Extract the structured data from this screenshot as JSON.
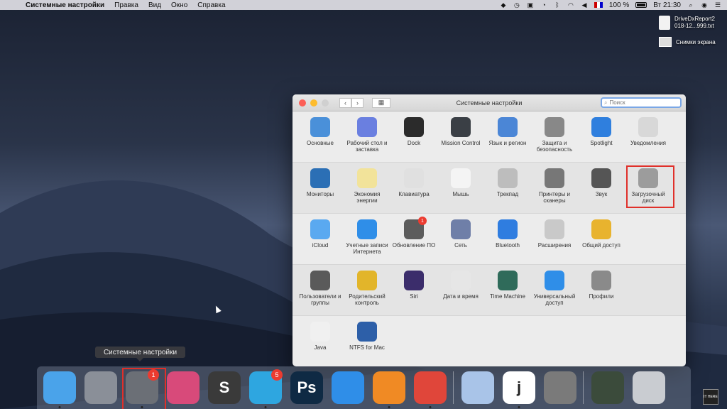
{
  "menubar": {
    "app_name": "Системные настройки",
    "items": [
      "Правка",
      "Вид",
      "Окно",
      "Справка"
    ],
    "battery": "100 %",
    "clock": "Вт 21:30"
  },
  "desktop": {
    "file1": {
      "name": "DriveDxReport2\n018-12...999.txt",
      "name_line1": "DriveDxReport2",
      "name_line2": "018-12...999.txt"
    },
    "file2": {
      "name": "Снимки экрана"
    }
  },
  "window": {
    "title": "Системные настройки",
    "search_placeholder": "Поиск",
    "rows": [
      [
        {
          "label": "Основные",
          "icon": "general-icon",
          "color": "#4a90d9"
        },
        {
          "label": "Рабочий стол и заставка",
          "icon": "desktop-icon",
          "color": "#6a7fe0"
        },
        {
          "label": "Dock",
          "icon": "dock-icon",
          "color": "#2b2b2b"
        },
        {
          "label": "Mission Control",
          "icon": "mission-control-icon",
          "color": "#3a3f45"
        },
        {
          "label": "Язык и регион",
          "icon": "language-icon",
          "color": "#4b86d6"
        },
        {
          "label": "Защита и безопасность",
          "icon": "security-icon",
          "color": "#888888"
        },
        {
          "label": "Spotlight",
          "icon": "spotlight-icon",
          "color": "#2f7fde"
        },
        {
          "label": "Уведомления",
          "icon": "notifications-icon",
          "color": "#d8d8d8"
        }
      ],
      [
        {
          "label": "Мониторы",
          "icon": "displays-icon",
          "color": "#2b6fb5"
        },
        {
          "label": "Экономия энергии",
          "icon": "energy-icon",
          "color": "#f2e39a"
        },
        {
          "label": "Клавиатура",
          "icon": "keyboard-icon",
          "color": "#e0e0e0"
        },
        {
          "label": "Мышь",
          "icon": "mouse-icon",
          "color": "#f4f4f4"
        },
        {
          "label": "Трекпад",
          "icon": "trackpad-icon",
          "color": "#bdbdbd"
        },
        {
          "label": "Принтеры и сканеры",
          "icon": "printers-icon",
          "color": "#777777"
        },
        {
          "label": "Звук",
          "icon": "sound-icon",
          "color": "#555555"
        },
        {
          "label": "Загрузочный диск",
          "icon": "startup-disk-icon",
          "color": "#9c9c9c"
        }
      ],
      [
        {
          "label": "iCloud",
          "icon": "icloud-icon",
          "color": "#5aa9f0"
        },
        {
          "label": "Учетные записи Интернета",
          "icon": "internet-accounts-icon",
          "color": "#2f8ee8"
        },
        {
          "label": "Обновление ПО",
          "icon": "software-update-icon",
          "color": "#5c5c5c",
          "badge": "1"
        },
        {
          "label": "Сеть",
          "icon": "network-icon",
          "color": "#6f7fa8"
        },
        {
          "label": "Bluetooth",
          "icon": "bluetooth-icon",
          "color": "#2f7de0"
        },
        {
          "label": "Расширения",
          "icon": "extensions-icon",
          "color": "#c9c9c9"
        },
        {
          "label": "Общий доступ",
          "icon": "sharing-icon",
          "color": "#e8b32e"
        }
      ],
      [
        {
          "label": "Пользователи и группы",
          "icon": "users-icon",
          "color": "#5a5a5a"
        },
        {
          "label": "Родительский контроль",
          "icon": "parental-icon",
          "color": "#e2b52a"
        },
        {
          "label": "Siri",
          "icon": "siri-icon",
          "color": "#3b2d6b"
        },
        {
          "label": "Дата и время",
          "icon": "date-time-icon",
          "color": "#e6e6e6"
        },
        {
          "label": "Time Machine",
          "icon": "time-machine-icon",
          "color": "#2f6b5a"
        },
        {
          "label": "Универсальный доступ",
          "icon": "accessibility-icon",
          "color": "#2f8ee8"
        },
        {
          "label": "Профили",
          "icon": "profiles-icon",
          "color": "#8a8a8a"
        }
      ],
      [
        {
          "label": "Java",
          "icon": "java-icon",
          "color": "#f0f0f0"
        },
        {
          "label": "NTFS for Mac",
          "icon": "ntfs-icon",
          "color": "#2d5fa8"
        }
      ]
    ]
  },
  "tooltip": "Системные настройки",
  "dock": {
    "apps": [
      {
        "name": "finder-icon",
        "color": "#4aa3ea"
      },
      {
        "name": "launchpad-icon",
        "color": "#8a8f98"
      },
      {
        "name": "system-preferences-icon",
        "color": "#6b6f76",
        "badge": "1"
      },
      {
        "name": "final-cut-icon",
        "color": "#d84a7a"
      },
      {
        "name": "sublime-icon",
        "color": "#3a3a3a",
        "glyph": "S"
      },
      {
        "name": "telegram-icon",
        "color": "#2ea6e0",
        "badge": "5"
      },
      {
        "name": "photoshop-icon",
        "color": "#0f2a44",
        "glyph": "Ps"
      },
      {
        "name": "safari-icon",
        "color": "#2f8ee8"
      },
      {
        "name": "airmail-icon",
        "color": "#f08a24"
      },
      {
        "name": "chrome-icon",
        "color": "#e0463a"
      },
      {
        "name": "keychain-icon",
        "color": "#a9c4e8"
      },
      {
        "name": "joplin-icon",
        "color": "#ffffff",
        "glyph": "j"
      },
      {
        "name": "photo-booth-icon",
        "color": "#7a7a7a"
      },
      {
        "name": "activity-monitor-icon",
        "color": "#3b4b3b"
      },
      {
        "name": "trash-icon",
        "color": "#c9ccd1"
      }
    ]
  },
  "corner_logo": "IT HERE"
}
